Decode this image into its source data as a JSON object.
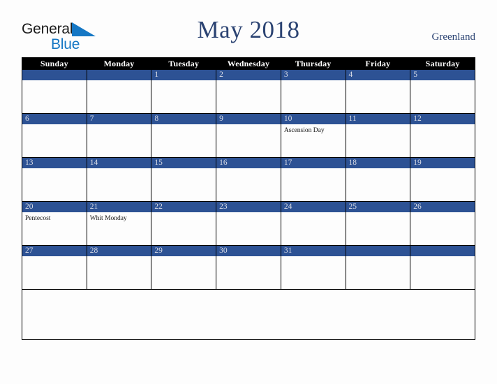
{
  "brand": {
    "name_top": "General",
    "name_bottom": "Blue",
    "triangle_color": "#1577c4",
    "top_color": "#1a1a1a",
    "bottom_color": "#1577c4"
  },
  "header": {
    "title": "May 2018",
    "region": "Greenland",
    "title_color": "#2b4372"
  },
  "colors": {
    "header_row_bg": "#000000",
    "header_row_text": "#ffffff",
    "day_number_bar": "#2d5294",
    "day_number_text": "#d9dce6",
    "cell_bg": "#fdfdfd",
    "grid_line": "#000000",
    "page_bg": "#fdfdfd"
  },
  "weekday_headers": [
    "Sunday",
    "Monday",
    "Tuesday",
    "Wednesday",
    "Thursday",
    "Friday",
    "Saturday"
  ],
  "weeks": [
    [
      {
        "day": "",
        "events": []
      },
      {
        "day": "",
        "events": []
      },
      {
        "day": "1",
        "events": []
      },
      {
        "day": "2",
        "events": []
      },
      {
        "day": "3",
        "events": []
      },
      {
        "day": "4",
        "events": []
      },
      {
        "day": "5",
        "events": []
      }
    ],
    [
      {
        "day": "6",
        "events": []
      },
      {
        "day": "7",
        "events": []
      },
      {
        "day": "8",
        "events": []
      },
      {
        "day": "9",
        "events": []
      },
      {
        "day": "10",
        "events": [
          "Ascension Day"
        ]
      },
      {
        "day": "11",
        "events": []
      },
      {
        "day": "12",
        "events": []
      }
    ],
    [
      {
        "day": "13",
        "events": []
      },
      {
        "day": "14",
        "events": []
      },
      {
        "day": "15",
        "events": []
      },
      {
        "day": "16",
        "events": []
      },
      {
        "day": "17",
        "events": []
      },
      {
        "day": "18",
        "events": []
      },
      {
        "day": "19",
        "events": []
      }
    ],
    [
      {
        "day": "20",
        "events": [
          "Pentecost"
        ]
      },
      {
        "day": "21",
        "events": [
          "Whit Monday"
        ]
      },
      {
        "day": "22",
        "events": []
      },
      {
        "day": "23",
        "events": []
      },
      {
        "day": "24",
        "events": []
      },
      {
        "day": "25",
        "events": []
      },
      {
        "day": "26",
        "events": []
      }
    ],
    [
      {
        "day": "27",
        "events": []
      },
      {
        "day": "28",
        "events": []
      },
      {
        "day": "29",
        "events": []
      },
      {
        "day": "30",
        "events": []
      },
      {
        "day": "31",
        "events": []
      },
      {
        "day": "",
        "events": []
      },
      {
        "day": "",
        "events": []
      }
    ]
  ]
}
